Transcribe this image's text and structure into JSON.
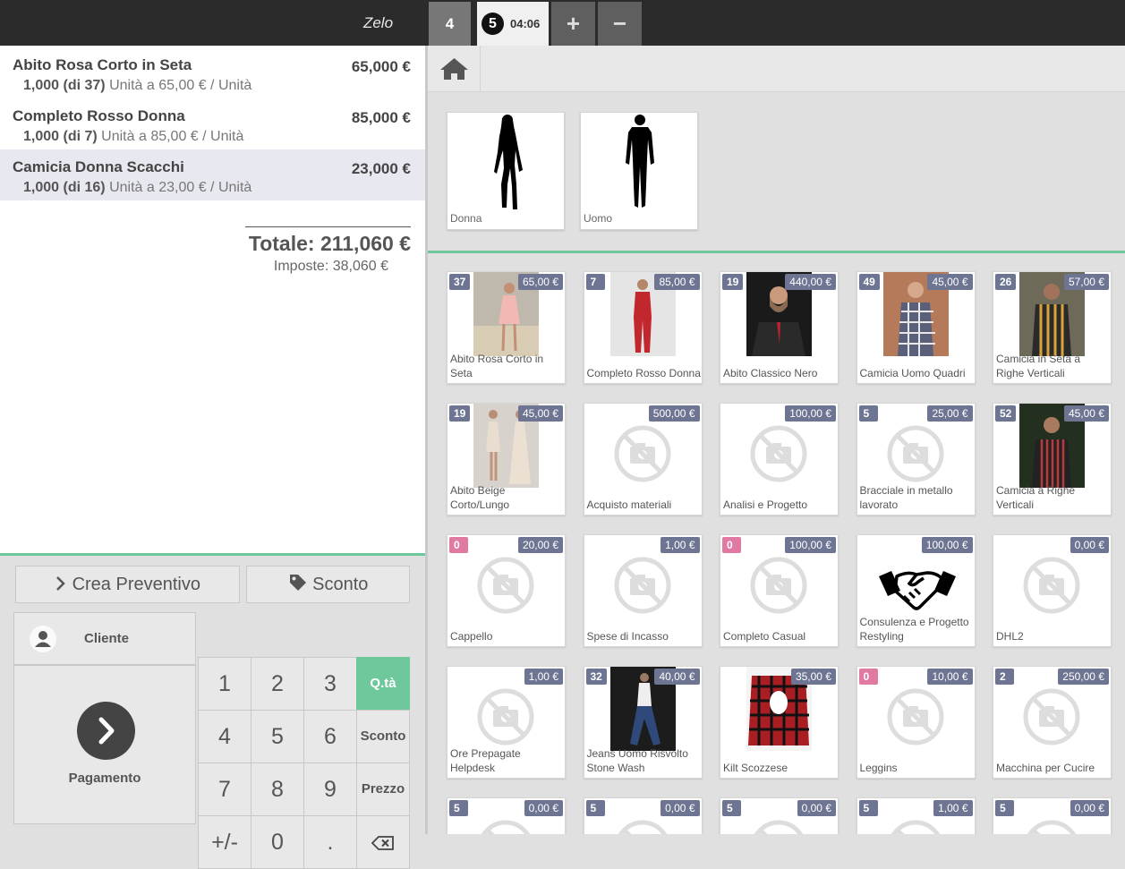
{
  "header": {
    "shop_name": "Zelo",
    "order_tab_1": "4",
    "order_tab_2_num": "5",
    "order_tab_2_time": "04:06",
    "add_order": "+",
    "remove_order": "−"
  },
  "order": {
    "lines": [
      {
        "name": "Abito Rosa Corto in Seta",
        "price": "65,000 €",
        "qty": "1,000",
        "stock": "(di 37)",
        "unit": "Unità a 65,00 € / Unità"
      },
      {
        "name": "Completo Rosso Donna",
        "price": "85,000 €",
        "qty": "1,000",
        "stock": "(di 7)",
        "unit": "Unità a 85,00 € / Unità"
      },
      {
        "name": "Camicia Donna Scacchi",
        "price": "23,000 €",
        "qty": "1,000",
        "stock": "(di 16)",
        "unit": "Unità a 23,00 € / Unità"
      }
    ],
    "total": "Totale: 211,060 €",
    "taxes": "Imposte: 38,060 €"
  },
  "controls": {
    "quote_button": "Crea Preventivo",
    "discount_button": "Sconto",
    "client_button": "Cliente",
    "payment_button": "Pagamento",
    "keys": [
      "1",
      "2",
      "3",
      "4",
      "5",
      "6",
      "7",
      "8",
      "9",
      "+/-",
      "0",
      "."
    ],
    "mode_qty": "Q.tà",
    "mode_discount": "Sconto",
    "mode_price": "Prezzo"
  },
  "categories": [
    {
      "name": "Donna"
    },
    {
      "name": "Uomo"
    }
  ],
  "products": [
    {
      "name": "Abito Rosa Corto in Seta",
      "qty": "37",
      "price": "65,00 €",
      "image": "dress-pink-photo"
    },
    {
      "name": "Completo Rosso Donna",
      "qty": "7",
      "price": "85,00 €",
      "image": "red-suit-photo"
    },
    {
      "name": "Abito Classico Nero",
      "qty": "19",
      "price": "440,00 €",
      "image": "black-suit-photo"
    },
    {
      "name": "Camicia Uomo Quadri",
      "qty": "49",
      "price": "45,00 €",
      "image": "checked-shirt-photo"
    },
    {
      "name": "Camicia in Seta a Righe Verticali",
      "qty": "26",
      "price": "57,00 €",
      "image": "striped-shirt-photo"
    },
    {
      "name": "Abito Beige Corto/Lungo",
      "qty": "19",
      "price": "45,00 €",
      "image": "beige-dress-photo"
    },
    {
      "name": "Acquisto materiali",
      "qty": "",
      "price": "500,00 €",
      "image": "no-image"
    },
    {
      "name": "Analisi e Progetto",
      "qty": "",
      "price": "100,00 €",
      "image": "no-image"
    },
    {
      "name": "Bracciale in metallo lavorato",
      "qty": "5",
      "price": "25,00 €",
      "image": "no-image"
    },
    {
      "name": "Camicia a Righe Verticali",
      "qty": "52",
      "price": "45,00 €",
      "image": "striped-shirt-2-photo"
    },
    {
      "name": "Cappello",
      "qty": "0",
      "price": "20,00 €",
      "image": "no-image"
    },
    {
      "name": "Spese di Incasso",
      "qty": "",
      "price": "1,00 €",
      "image": "no-image"
    },
    {
      "name": "Completo Casual",
      "qty": "0",
      "price": "100,00 €",
      "image": "no-image"
    },
    {
      "name": "Consulenza e Progetto Restyling",
      "qty": "",
      "price": "100,00 €",
      "image": "handshake-icon"
    },
    {
      "name": "DHL2",
      "qty": "",
      "price": "0,00 €",
      "image": "no-image"
    },
    {
      "name": "Ore Prepagate Helpdesk",
      "qty": "",
      "price": "1,00 €",
      "image": "no-image"
    },
    {
      "name": "Jeans Uomo Risvolto Stone Wash",
      "qty": "32",
      "price": "40,00 €",
      "image": "jeans-photo"
    },
    {
      "name": "Kilt Scozzese",
      "qty": "",
      "price": "35,00 €",
      "image": "kilt-photo"
    },
    {
      "name": "Leggins",
      "qty": "0",
      "price": "10,00 €",
      "image": "no-image"
    },
    {
      "name": "Macchina per Cucire",
      "qty": "2",
      "price": "250,00 €",
      "image": "no-image"
    },
    {
      "name": "",
      "qty": "5",
      "price": "0,00 €",
      "image": "no-image"
    },
    {
      "name": "",
      "qty": "5",
      "price": "0,00 €",
      "image": "no-image"
    },
    {
      "name": "",
      "qty": "5",
      "price": "0,00 €",
      "image": "no-image"
    },
    {
      "name": "",
      "qty": "5",
      "price": "1,00 €",
      "image": "no-image"
    },
    {
      "name": "",
      "qty": "5",
      "price": "0,00 €",
      "image": "no-image"
    }
  ],
  "colors": {
    "accent_green": "#6ec89b",
    "badge": "#6e7593",
    "badge_zero": "#e07aa3",
    "topbar": "#2b2b2b"
  }
}
